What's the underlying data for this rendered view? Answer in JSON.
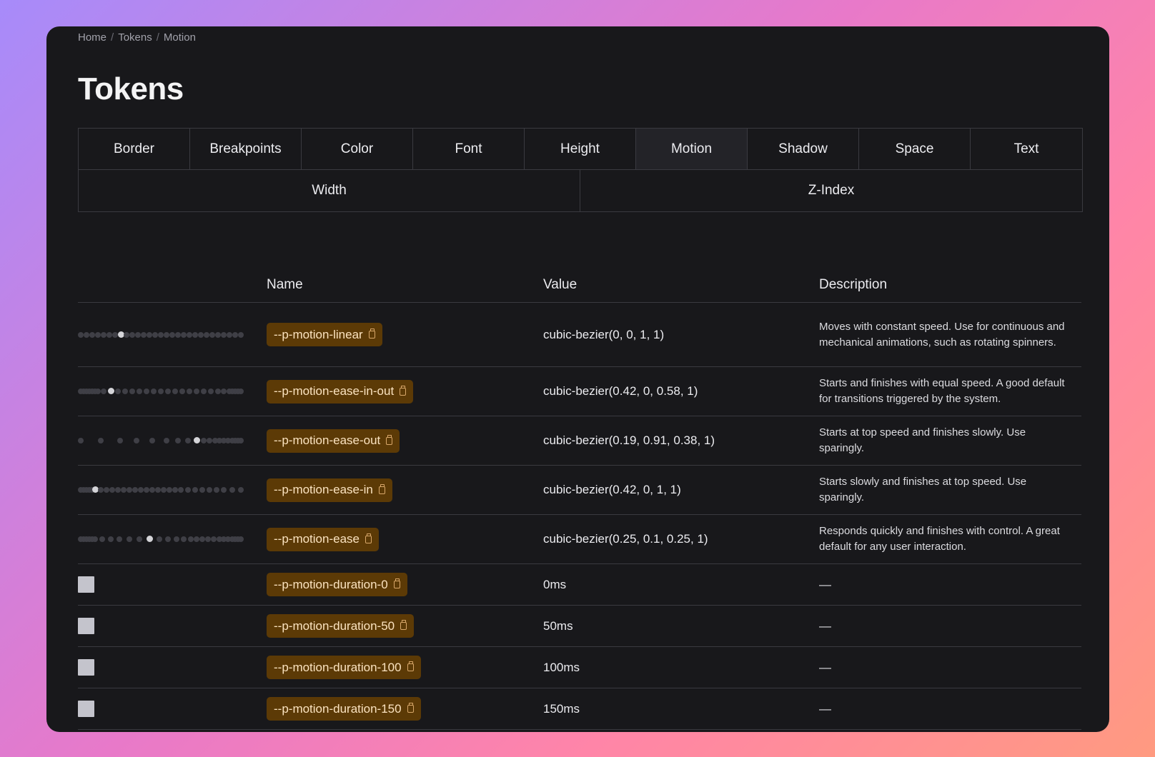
{
  "breadcrumb": [
    "Home",
    "Tokens",
    "Motion"
  ],
  "page_title": "Tokens",
  "tabs_row1": [
    "Border",
    "Breakpoints",
    "Color",
    "Font",
    "Height",
    "Motion",
    "Shadow",
    "Space",
    "Text"
  ],
  "tabs_row2": [
    "Width",
    "Z-Index"
  ],
  "active_tab": "Motion",
  "table": {
    "headers": [
      "",
      "Name",
      "Value",
      "Description"
    ],
    "rows": [
      {
        "name": "--p-motion-linear",
        "value": "cubic-bezier(0, 0, 1, 1)",
        "description": "Moves with constant speed. Use for continuous and mechanical animations, such as rotating spinners.",
        "preview": "easing",
        "height": 90
      },
      {
        "name": "--p-motion-ease-in-out",
        "value": "cubic-bezier(0.42, 0, 0.58, 1)",
        "description": "Starts and finishes with equal speed. A good default for transitions triggered by the system.",
        "preview": "easing",
        "height": 68
      },
      {
        "name": "--p-motion-ease-out",
        "value": "cubic-bezier(0.19, 0.91, 0.38, 1)",
        "description": "Starts at top speed and finishes slowly. Use sparingly.",
        "preview": "easing",
        "height": 68
      },
      {
        "name": "--p-motion-ease-in",
        "value": "cubic-bezier(0.42, 0, 1, 1)",
        "description": "Starts slowly and finishes at top speed. Use sparingly.",
        "preview": "easing",
        "height": 68
      },
      {
        "name": "--p-motion-ease",
        "value": "cubic-bezier(0.25, 0.1, 0.25, 1)",
        "description": "Responds quickly and finishes with control. A great default for any user interaction.",
        "preview": "easing",
        "height": 68
      },
      {
        "name": "--p-motion-duration-0",
        "value": "0ms",
        "description": "—",
        "preview": "square",
        "height": 58
      },
      {
        "name": "--p-motion-duration-50",
        "value": "50ms",
        "description": "—",
        "preview": "square",
        "height": 58
      },
      {
        "name": "--p-motion-duration-100",
        "value": "100ms",
        "description": "—",
        "preview": "square",
        "height": 58
      },
      {
        "name": "--p-motion-duration-150",
        "value": "150ms",
        "description": "—",
        "preview": "square",
        "height": 58
      }
    ]
  },
  "colors": {
    "pill_bg": "#5c3a06",
    "pill_text": "#fbe3c0",
    "window_bg": "#18181b"
  }
}
